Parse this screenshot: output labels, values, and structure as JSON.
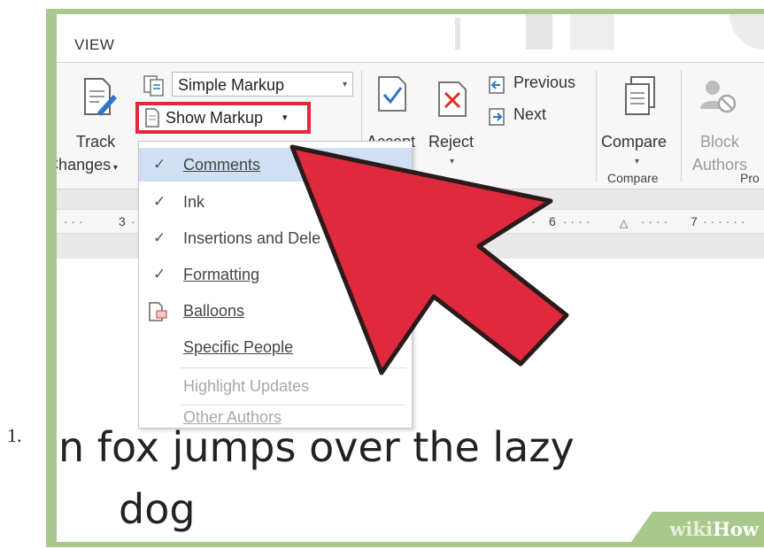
{
  "list_marker": "1.",
  "ribbon": {
    "tab": "VIEW",
    "track_changes": {
      "line1": "Track",
      "line2": "Changes"
    },
    "markup_display": "Simple Markup",
    "show_markup": "Show Markup",
    "accept": "Accept",
    "reject": "Reject",
    "previous": "Previous",
    "next": "Next",
    "compare": "Compare",
    "compare_group": "Compare",
    "block_authors": {
      "line1": "Block",
      "line2": "Authors"
    },
    "protect_group": "Pro"
  },
  "ruler": {
    "tick3": "3",
    "tick6": "6",
    "tick7": "7"
  },
  "menu": {
    "comments": "Comments",
    "ink": "Ink",
    "insertions": "Insertions and Dele",
    "formatting": "Formatting",
    "balloons": "Balloons",
    "specific_people": "Specific People",
    "highlight_updates": "Highlight Updates",
    "other_authors": "Other Authors"
  },
  "document": {
    "line1": "n fox jumps over the lazy",
    "line2": "dog"
  },
  "watermark": {
    "part1": "wiki",
    "part2": "How"
  },
  "colors": {
    "accent_red": "#e0293c",
    "frame_green": "#a9c98c",
    "highlight_blue": "#cfe0f4",
    "check_blue": "#2e75c7"
  }
}
